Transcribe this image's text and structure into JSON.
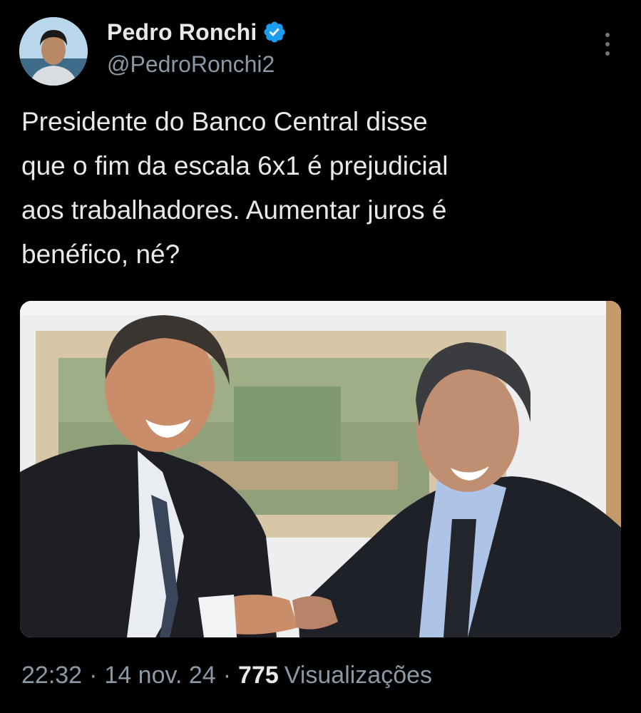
{
  "author": {
    "display_name": "Pedro Ronchi",
    "handle": "@PedroRonchi2",
    "verified": true
  },
  "tweet": {
    "text": "Presidente do Banco Central disse\nque o fim da escala 6x1 é prejudicial\naos trabalhadores. Aumentar juros é\nbenéfico, né?"
  },
  "meta": {
    "time": "22:32",
    "separator": "·",
    "date": "14 nov. 24",
    "views_count": "775",
    "views_label": "Visualizações"
  },
  "colors": {
    "background": "#000000",
    "text": "#e7e9ea",
    "secondary": "#8b98a5",
    "verified": "#1d9bf0"
  },
  "icons": {
    "verified": "verified-badge-icon",
    "more": "more-options-icon"
  }
}
